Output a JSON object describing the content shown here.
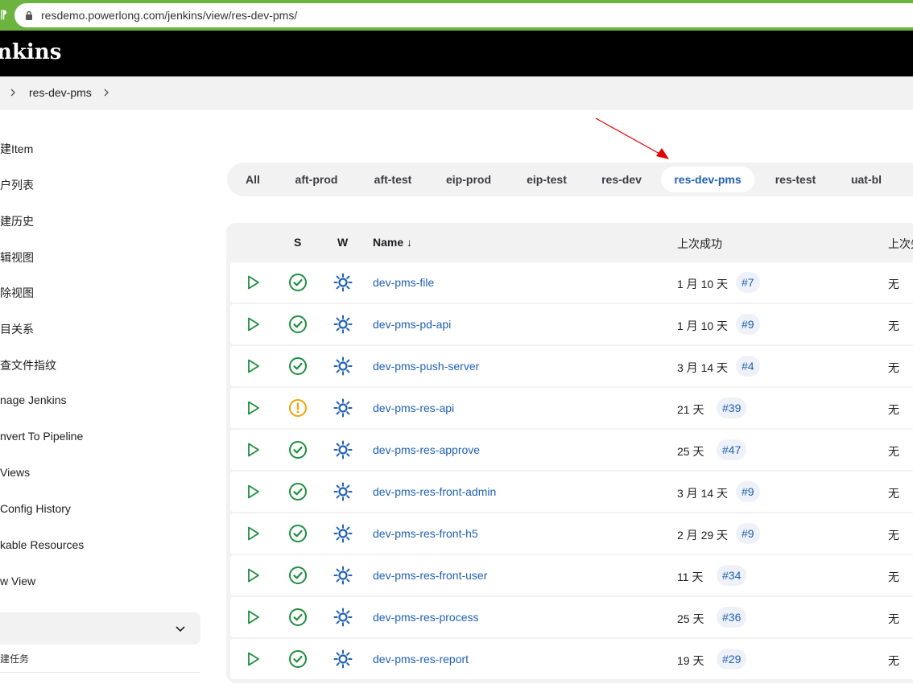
{
  "browser": {
    "url": "resdemo.powerlong.com/jenkins/view/res-dev-pms/"
  },
  "header": {
    "title": "nkins"
  },
  "breadcrumb": {
    "current": "res-dev-pms"
  },
  "sidebar": {
    "items": [
      {
        "label": "建Item"
      },
      {
        "label": "户列表"
      },
      {
        "label": "建历史"
      },
      {
        "label": "辑视图"
      },
      {
        "label": "除视图"
      },
      {
        "label": "目关系"
      },
      {
        "label": "查文件指纹"
      },
      {
        "label": "nage Jenkins"
      },
      {
        "label": "nvert To Pipeline"
      },
      {
        "label": "Views"
      },
      {
        "label": "Config History"
      },
      {
        "label": "kable Resources"
      },
      {
        "label": "w View"
      }
    ],
    "queue_sub": "建任务"
  },
  "tabs": [
    {
      "label": "All",
      "active": false
    },
    {
      "label": "aft-prod",
      "active": false
    },
    {
      "label": "aft-test",
      "active": false
    },
    {
      "label": "eip-prod",
      "active": false
    },
    {
      "label": "eip-test",
      "active": false
    },
    {
      "label": "res-dev",
      "active": false
    },
    {
      "label": "res-dev-pms",
      "active": true
    },
    {
      "label": "res-test",
      "active": false
    },
    {
      "label": "uat-bl",
      "active": false
    }
  ],
  "table": {
    "headers": {
      "s": "S",
      "w": "W",
      "name": "Name ↓",
      "last_success": "上次成功",
      "last_failure": "上次失"
    },
    "rows": [
      {
        "name": "dev-pms-file",
        "status": "success",
        "last_success": "1 月 10 天",
        "build": "#7",
        "last_failure": "无"
      },
      {
        "name": "dev-pms-pd-api",
        "status": "success",
        "last_success": "1 月 10 天",
        "build": "#9",
        "last_failure": "无"
      },
      {
        "name": "dev-pms-push-server",
        "status": "success",
        "last_success": "3 月 14 天",
        "build": "#4",
        "last_failure": "无"
      },
      {
        "name": "dev-pms-res-api",
        "status": "unstable",
        "last_success": "21 天",
        "build": "#39",
        "last_failure": "无"
      },
      {
        "name": "dev-pms-res-approve",
        "status": "success",
        "last_success": "25 天",
        "build": "#47",
        "last_failure": "无"
      },
      {
        "name": "dev-pms-res-front-admin",
        "status": "success",
        "last_success": "3 月 14 天",
        "build": "#9",
        "last_failure": "无"
      },
      {
        "name": "dev-pms-res-front-h5",
        "status": "success",
        "last_success": "2 月 29 天",
        "build": "#9",
        "last_failure": "无"
      },
      {
        "name": "dev-pms-res-front-user",
        "status": "success",
        "last_success": "11 天",
        "build": "#34",
        "last_failure": "无"
      },
      {
        "name": "dev-pms-res-process",
        "status": "success",
        "last_success": "25 天",
        "build": "#36",
        "last_failure": "无"
      },
      {
        "name": "dev-pms-res-report",
        "status": "success",
        "last_success": "19 天",
        "build": "#29",
        "last_failure": "无"
      }
    ]
  },
  "colors": {
    "success": "#1e8e3e",
    "unstable": "#f0a30a",
    "link": "#1f5fb4",
    "accent": "#6cb33f",
    "annotation": "#e00000"
  }
}
